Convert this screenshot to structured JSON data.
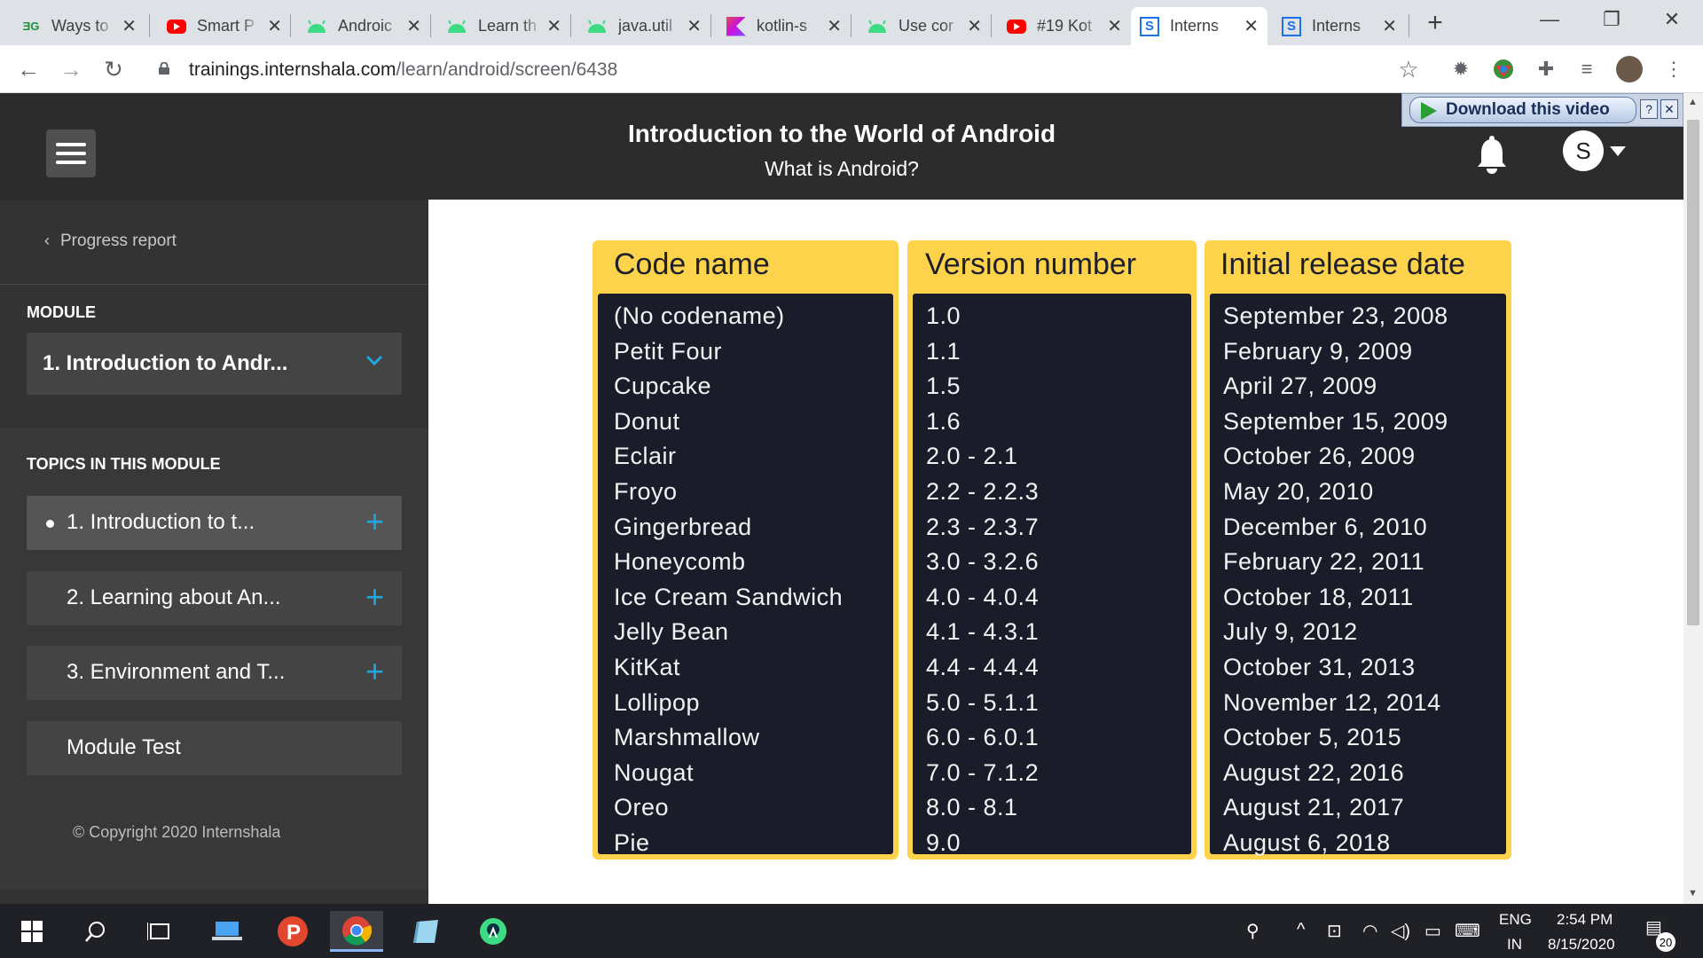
{
  "browser": {
    "tabs": [
      {
        "title": "Ways to",
        "icon": "dg-favicon"
      },
      {
        "title": "Smart P",
        "icon": "youtube-icon"
      },
      {
        "title": "Androic",
        "icon": "android-icon"
      },
      {
        "title": "Learn th",
        "icon": "android-icon"
      },
      {
        "title": "java.util",
        "icon": "android-icon"
      },
      {
        "title": "kotlin-s",
        "icon": "kotlin-icon"
      },
      {
        "title": "Use cor",
        "icon": "android-icon"
      },
      {
        "title": "#19 Kot",
        "icon": "youtube-icon"
      },
      {
        "title": "Interns",
        "icon": "internshala-icon",
        "active": true
      },
      {
        "title": "Interns",
        "icon": "internshala-icon"
      }
    ],
    "new_tab": "+",
    "url_host": "trainings.internshala.com",
    "url_path": "/learn/android/screen/6438"
  },
  "video_helper": {
    "download_label": "Download this video",
    "help": "?",
    "close": "✕"
  },
  "header": {
    "course_title": "Introduction to the World of Android",
    "topic_title": "What is Android?",
    "avatar_initial": "S"
  },
  "sidebar": {
    "progress_report": "Progress report",
    "module_label": "MODULE",
    "module_selected": "1. Introduction to Andr...",
    "topics_label": "TOPICS IN THIS MODULE",
    "topics": [
      {
        "label": "1. Introduction to t...",
        "current": true
      },
      {
        "label": "2. Learning about An..."
      },
      {
        "label": "3. Environment and T..."
      }
    ],
    "module_test": "Module Test",
    "copyright": "© Copyright 2020 Internshala"
  },
  "table": {
    "headers": [
      "Code name",
      "Version number",
      "Initial release date"
    ],
    "code_names": [
      "(No codename)",
      "Petit Four",
      "Cupcake",
      "Donut",
      "Eclair",
      "Froyo",
      "Gingerbread",
      "Honeycomb",
      "Ice Cream Sandwich",
      "Jelly Bean",
      "KitKat",
      "Lollipop",
      "Marshmallow",
      "Nougat",
      "Oreo",
      "Pie"
    ],
    "versions": [
      "1.0",
      "1.1",
      "1.5",
      "1.6",
      "2.0 - 2.1",
      "2.2 - 2.2.3",
      "2.3 - 2.3.7",
      "3.0 - 3.2.6",
      "4.0 - 4.0.4",
      "4.1 - 4.3.1",
      "4.4 - 4.4.4",
      "5.0 - 5.1.1",
      "6.0 - 6.0.1",
      "7.0 - 7.1.2",
      "8.0 - 8.1",
      "9.0"
    ],
    "release_dates": [
      "September 23, 2008",
      "February 9, 2009",
      "April 27, 2009",
      "September 15, 2009",
      "October 26, 2009",
      "May 20, 2010",
      "December 6, 2010",
      "February 22, 2011",
      "October 18, 2011",
      "July 9, 2012",
      "October 31, 2013",
      "November 12, 2014",
      "October 5, 2015",
      "August 22, 2016",
      "August 21, 2017",
      "August 6, 2018"
    ]
  },
  "taskbar": {
    "lang_top": "ENG",
    "lang_bottom": "IN",
    "time": "2:54 PM",
    "date": "8/15/2020",
    "notifications": "20"
  },
  "colors": {
    "accent_yellow": "#fdd34c",
    "table_dark": "#1a1d29",
    "plus_blue": "#1fa7e0",
    "header_bg": "#2c2c2c",
    "sidebar_bg": "#333333"
  }
}
